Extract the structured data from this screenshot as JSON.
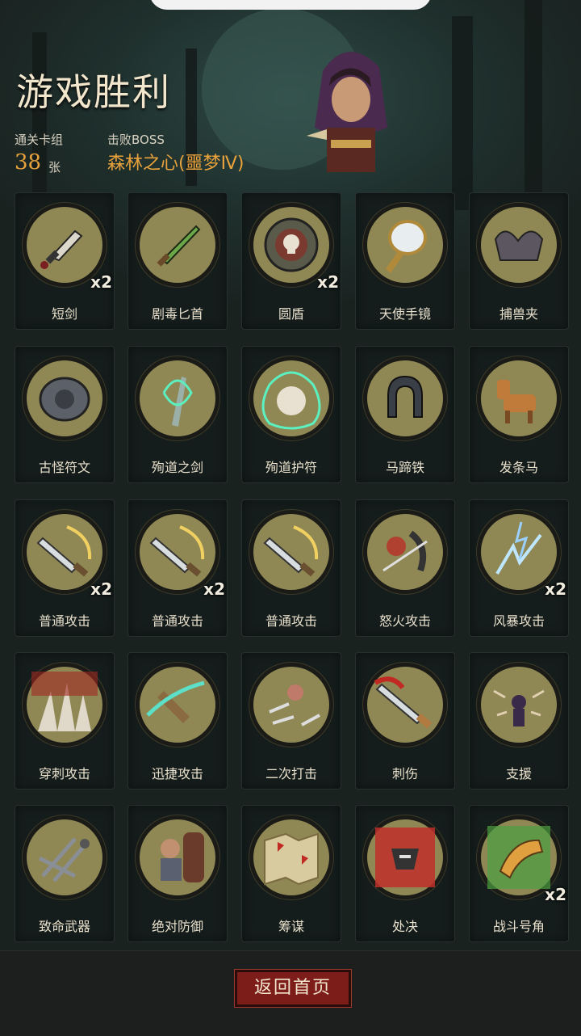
{
  "header": {
    "title": "游戏胜利",
    "deck_label": "通关卡组",
    "deck_count": "38",
    "deck_unit": "张",
    "boss_label": "击败BOSS",
    "boss_name": "森林之心(噩梦Ⅳ)"
  },
  "cards": [
    {
      "name": "短剑",
      "qty": "x2",
      "icon": "dagger-icon"
    },
    {
      "name": "剧毒匕首",
      "qty": "",
      "icon": "poison-dagger-icon"
    },
    {
      "name": "圆盾",
      "qty": "x2",
      "icon": "round-shield-icon"
    },
    {
      "name": "天使手镜",
      "qty": "",
      "icon": "hand-mirror-icon"
    },
    {
      "name": "捕兽夹",
      "qty": "",
      "icon": "bear-trap-icon"
    },
    {
      "name": "古怪符文",
      "qty": "",
      "icon": "rune-stone-icon"
    },
    {
      "name": "殉道之剑",
      "qty": "",
      "icon": "martyr-sword-icon"
    },
    {
      "name": "殉道护符",
      "qty": "",
      "icon": "martyr-amulet-icon"
    },
    {
      "name": "马蹄铁",
      "qty": "",
      "icon": "horseshoe-icon"
    },
    {
      "name": "发条马",
      "qty": "",
      "icon": "clockwork-horse-icon"
    },
    {
      "name": "普通攻击",
      "qty": "x2",
      "icon": "sword-slash-icon"
    },
    {
      "name": "普通攻击",
      "qty": "x2",
      "icon": "sword-slash-icon"
    },
    {
      "name": "普通攻击",
      "qty": "",
      "icon": "sword-slash-icon"
    },
    {
      "name": "怒火攻击",
      "qty": "",
      "icon": "rage-attack-icon"
    },
    {
      "name": "风暴攻击",
      "qty": "x2",
      "icon": "storm-attack-icon"
    },
    {
      "name": "穿刺攻击",
      "qty": "",
      "icon": "pierce-attack-icon"
    },
    {
      "name": "迅捷攻击",
      "qty": "",
      "icon": "swift-attack-icon"
    },
    {
      "name": "二次打击",
      "qty": "",
      "icon": "double-strike-icon"
    },
    {
      "name": "刺伤",
      "qty": "",
      "icon": "stab-icon"
    },
    {
      "name": "支援",
      "qty": "",
      "icon": "support-icon"
    },
    {
      "name": "致命武器",
      "qty": "",
      "icon": "deadly-weapons-icon"
    },
    {
      "name": "绝对防御",
      "qty": "",
      "icon": "absolute-defense-icon"
    },
    {
      "name": "筹谋",
      "qty": "",
      "icon": "scheme-map-icon"
    },
    {
      "name": "处决",
      "qty": "",
      "icon": "execution-icon"
    },
    {
      "name": "战斗号角",
      "qty": "x2",
      "icon": "war-horn-icon"
    }
  ],
  "footer": {
    "back_label": "返回首页"
  },
  "colors": {
    "accent": "#e8a23c",
    "button": "#7c1d1a",
    "medal": "#8f8754"
  }
}
